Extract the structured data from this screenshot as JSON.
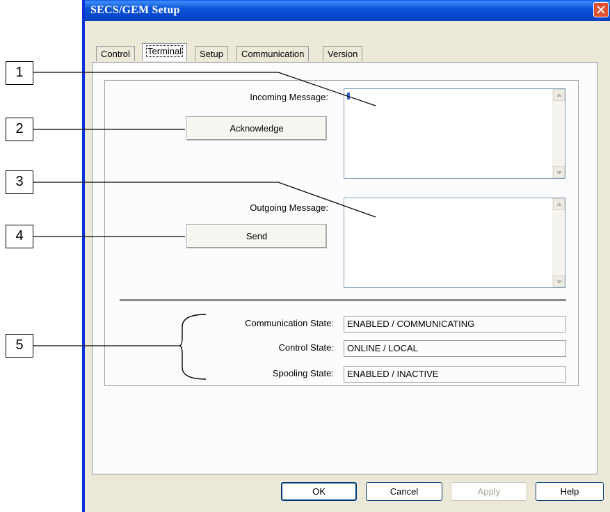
{
  "window": {
    "title": "SECS/GEM Setup"
  },
  "tabs": [
    {
      "label": "Control"
    },
    {
      "label": "Terminal"
    },
    {
      "label": "Setup"
    },
    {
      "label": "Communication"
    },
    {
      "label": "Version"
    }
  ],
  "terminal": {
    "incoming_label": "Incoming Message:",
    "outgoing_label": "Outgoing Message:",
    "acknowledge_label": "Acknowledge",
    "send_label": "Send",
    "incoming_value": "",
    "outgoing_value": ""
  },
  "states": {
    "communication_label": "Communication State:",
    "communication_value": "ENABLED / COMMUNICATING",
    "control_label": "Control State:",
    "control_value": "ONLINE / LOCAL",
    "spooling_label": "Spooling State:",
    "spooling_value": "ENABLED / INACTIVE"
  },
  "buttons": {
    "ok": "OK",
    "cancel": "Cancel",
    "apply": "Apply",
    "help": "Help"
  },
  "callouts": [
    "1",
    "2",
    "3",
    "4",
    "5"
  ],
  "colors": {
    "titlebar": "#0a55d8",
    "close": "#e2512e",
    "dialog_bg": "#ece9d8",
    "page_bg": "#fcfcfe"
  },
  "icons": {
    "close": "close-icon",
    "scroll_up": "scroll-up-icon",
    "scroll_down": "scroll-down-icon"
  }
}
